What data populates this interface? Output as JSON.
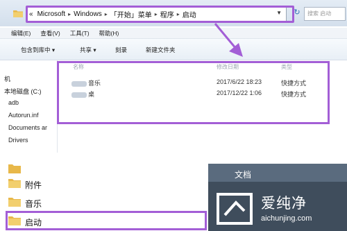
{
  "address_bar": {
    "segments": [
      "Microsoft",
      "Windows",
      "「开始」菜单",
      "程序",
      "启动"
    ],
    "back_glyph": "«",
    "search_placeholder": "搜索 启动"
  },
  "menu": [
    "编辑(E)",
    "查看(V)",
    "工具(T)",
    "帮助(H)"
  ],
  "toolbar": {
    "include_library": "包含到库中 ▾",
    "share": "共享 ▾",
    "burn": "刻录",
    "new_folder": "新建文件夹"
  },
  "nav_pane": {
    "items": [
      "机",
      "本地磁盘 (C:)",
      "adb",
      "Autorun.inf",
      "Documents ar",
      "Drivers"
    ]
  },
  "columns": {
    "name": "名称",
    "modified": "修改日期",
    "type": "类型"
  },
  "files": [
    {
      "name": "音乐",
      "modified": "2017/6/22 18:23",
      "type": "快捷方式"
    },
    {
      "name": "桌",
      "modified": "2017/12/22 1:06",
      "type": "快捷方式"
    }
  ],
  "start_menu": {
    "items": [
      "附件",
      "音乐",
      "启动"
    ]
  },
  "right_panel": {
    "documents": "文档"
  },
  "watermark": {
    "brand": "爱纯净",
    "url": "aichunjing.com"
  },
  "colors": {
    "highlight": "#a35ed6",
    "folder": "#e8b84a"
  }
}
